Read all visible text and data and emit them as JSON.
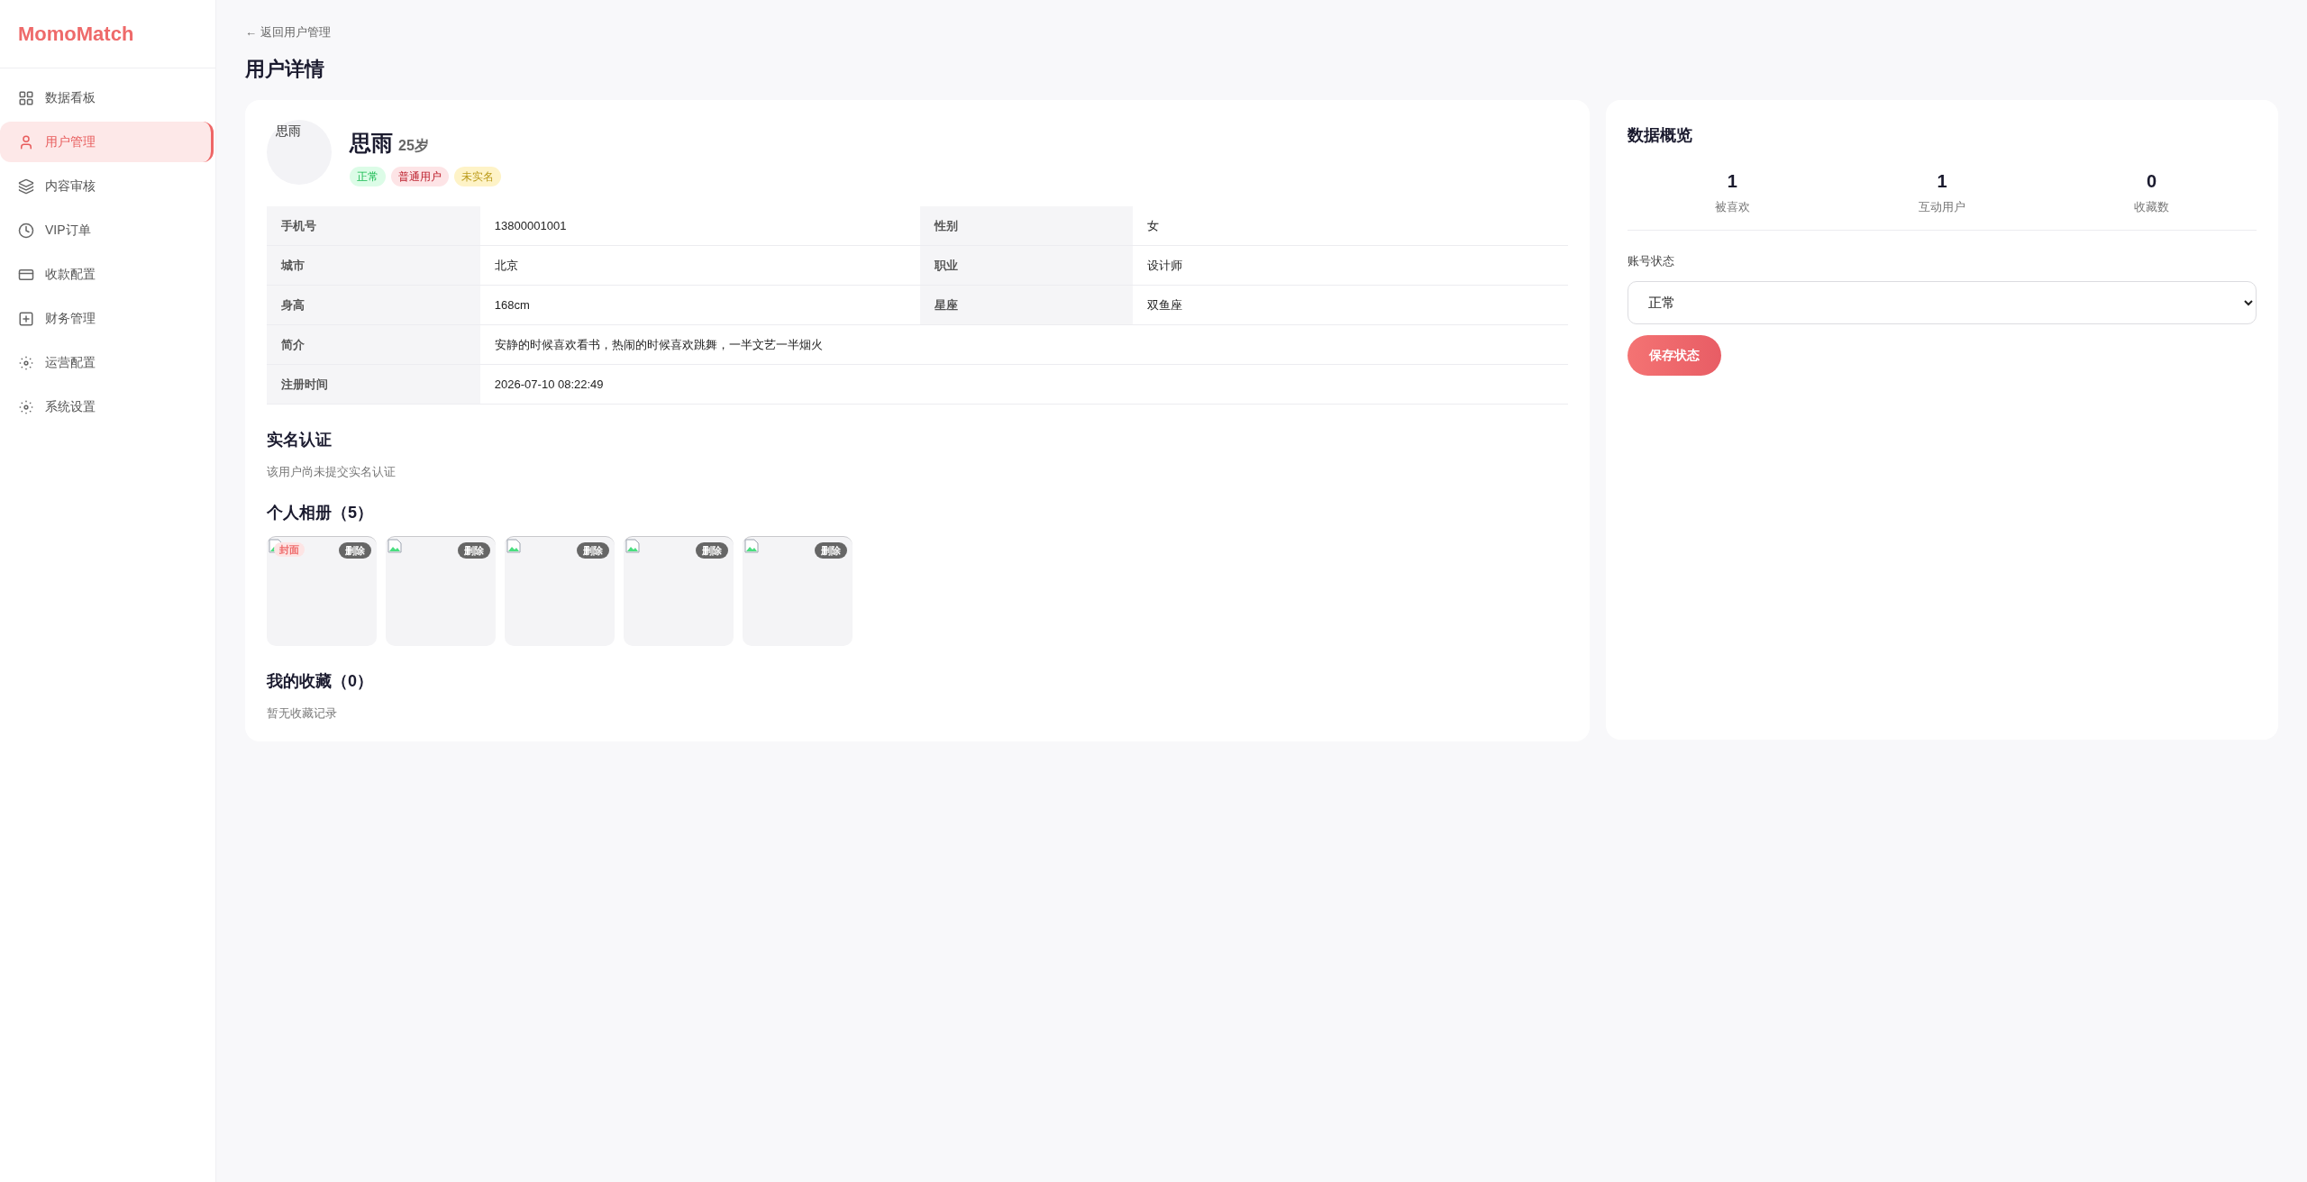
{
  "brand": "MomoMatch",
  "sidebar": {
    "items": [
      {
        "label": "数据看板",
        "selected": false
      },
      {
        "label": "用户管理",
        "selected": true
      },
      {
        "label": "内容审核",
        "selected": false
      },
      {
        "label": "VIP订单",
        "selected": false
      },
      {
        "label": "收款配置",
        "selected": false
      },
      {
        "label": "财务管理",
        "selected": false
      },
      {
        "label": "运营配置",
        "selected": false
      },
      {
        "label": "系统设置",
        "selected": false
      }
    ]
  },
  "back_link": "← 返回用户管理",
  "page_title": "用户详情",
  "profile": {
    "avatar_alt": "思雨",
    "name": "思雨",
    "age": "25岁",
    "tags": [
      {
        "label": "正常",
        "color": "#dcfce7"
      },
      {
        "label": "普通用户",
        "color": "#fde4e6"
      },
      {
        "label": "未实名",
        "color": "#fef3c7"
      }
    ]
  },
  "details": {
    "rows": [
      [
        {
          "label": "手机号",
          "value": "13800001001"
        },
        {
          "label": "性别",
          "value": "女"
        }
      ],
      [
        {
          "label": "城市",
          "value": "北京"
        },
        {
          "label": "职业",
          "value": "设计师"
        }
      ],
      [
        {
          "label": "身高",
          "value": "168cm"
        },
        {
          "label": "星座",
          "value": "双鱼座"
        }
      ],
      [
        {
          "label": "简介",
          "value": "安静的时候喜欢看书，热闹的时候喜欢跳舞，一半文艺一半烟火"
        }
      ],
      [
        {
          "label": "注册时间",
          "value": "2026-07-10 08:22:49"
        }
      ]
    ]
  },
  "verification": {
    "title": "实名认证",
    "text": "该用户尚未提交实名认证"
  },
  "album": {
    "title": "个人相册（5）",
    "photos": [
      {
        "cover_label": "封面",
        "delete_label": "删除"
      },
      {
        "delete_label": "删除"
      },
      {
        "delete_label": "删除"
      },
      {
        "delete_label": "删除"
      },
      {
        "delete_label": "删除"
      }
    ]
  },
  "favorites": {
    "title": "我的收藏（0）",
    "empty_text": "暂无收藏记录"
  },
  "overview": {
    "title": "数据概览",
    "stats": [
      {
        "value": "1",
        "label": "被喜欢"
      },
      {
        "value": "1",
        "label": "互动用户"
      },
      {
        "value": "0",
        "label": "收藏数"
      }
    ],
    "status_label": "账号状态",
    "status_value": "正常",
    "save_button": "保存状态"
  }
}
